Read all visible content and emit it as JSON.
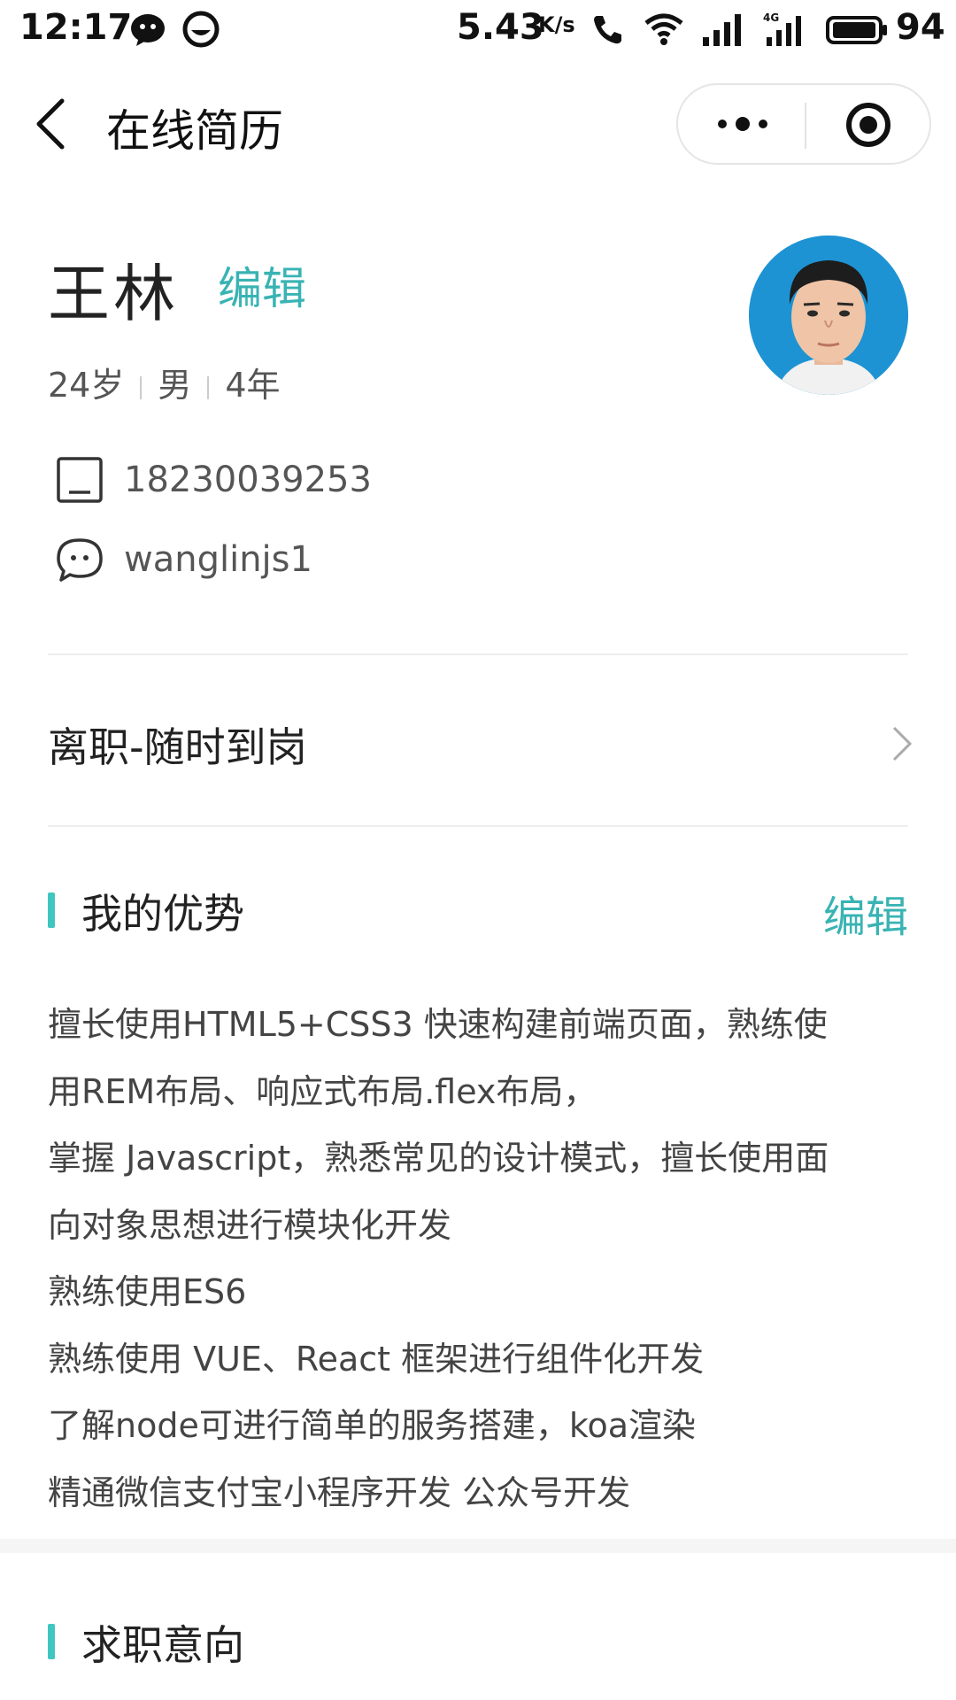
{
  "status_bar": {
    "time": "12:17",
    "speed": "5.43",
    "speed_unit": "K/s",
    "battery": "94"
  },
  "nav": {
    "title": "在线简历"
  },
  "profile": {
    "name": "王林",
    "edit_label": "编辑",
    "age": "24岁",
    "gender": "男",
    "experience": "4年",
    "phone": "18230039253",
    "wechat": "wanglinjs1"
  },
  "job_status": {
    "label": "离职-随时到岗"
  },
  "advantages": {
    "title": "我的优势",
    "edit_label": "编辑",
    "lines": [
      "擅长使用HTML5+CSS3 快速构建前端页面，熟练使",
      "用REM布局、响应式布局.flex布局，",
      "掌握 Javascript，熟悉常见的设计模式，擅长使用面",
      "向对象思想进行模块化开发",
      "熟练使用ES6",
      "熟练使用 VUE、React 框架进行组件化开发",
      "了解node可进行简单的服务搭建，koa渲染",
      "精通微信支付宝小程序开发 公众号开发"
    ]
  },
  "intent": {
    "title": "求职意向"
  },
  "colors": {
    "accent": "#39b3b3",
    "section_bar": "#3fc6c0",
    "avatar_bg": "#1e93d3"
  }
}
